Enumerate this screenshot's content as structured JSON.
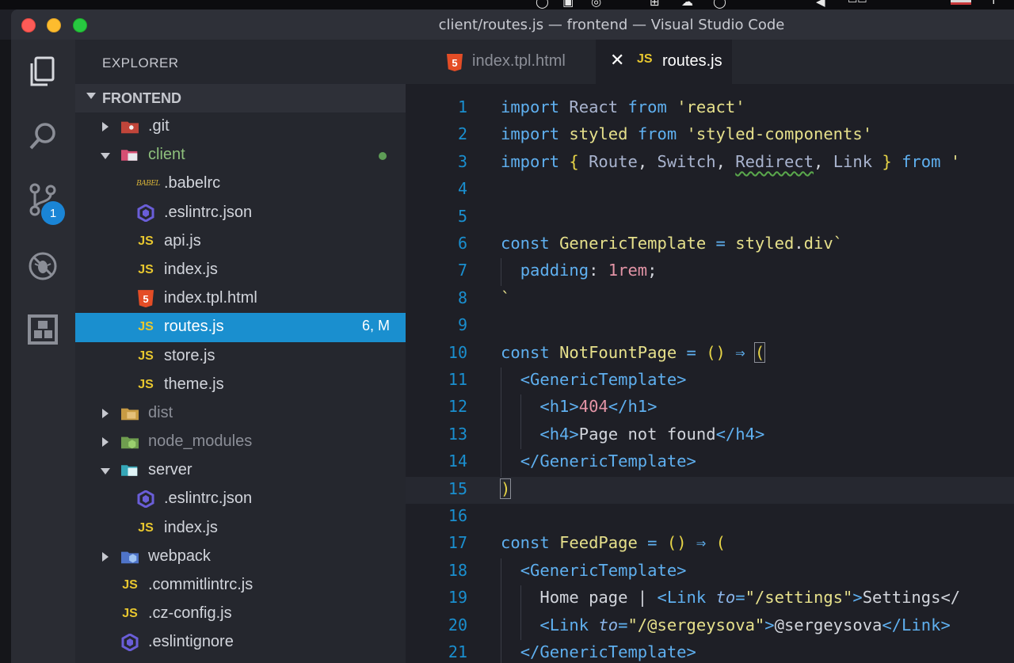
{
  "window": {
    "title": "client/routes.js — frontend — Visual Studio Code"
  },
  "activity_bar": {
    "items": [
      "explorer",
      "search",
      "source-control",
      "debug",
      "extensions"
    ],
    "scm_badge": "1"
  },
  "sidebar": {
    "title": "EXPLORER",
    "section": "FRONTEND",
    "tree": [
      {
        "name": ".git",
        "type": "folder",
        "state": "closed",
        "depth": 0
      },
      {
        "name": "client",
        "type": "folder",
        "state": "open",
        "depth": 0,
        "modified_dot": true
      },
      {
        "name": ".babelrc",
        "type": "babel",
        "depth": 1
      },
      {
        "name": ".eslintrc.json",
        "type": "eslint",
        "depth": 1
      },
      {
        "name": "api.js",
        "type": "js",
        "depth": 1
      },
      {
        "name": "index.js",
        "type": "js",
        "depth": 1
      },
      {
        "name": "index.tpl.html",
        "type": "html",
        "depth": 1
      },
      {
        "name": "routes.js",
        "type": "js",
        "depth": 1,
        "selected": true,
        "badge": "6, M"
      },
      {
        "name": "store.js",
        "type": "js",
        "depth": 1
      },
      {
        "name": "theme.js",
        "type": "js",
        "depth": 1
      },
      {
        "name": "dist",
        "type": "folder",
        "state": "closed",
        "depth": 0
      },
      {
        "name": "node_modules",
        "type": "folder",
        "state": "closed",
        "depth": 0
      },
      {
        "name": "server",
        "type": "folder",
        "state": "open",
        "depth": 0
      },
      {
        "name": ".eslintrc.json",
        "type": "eslint",
        "depth": 1
      },
      {
        "name": "index.js",
        "type": "js",
        "depth": 1
      },
      {
        "name": "webpack",
        "type": "folder",
        "state": "closed",
        "depth": 0
      },
      {
        "name": ".commitlintrc.js",
        "type": "js",
        "depth": 0
      },
      {
        "name": ".cz-config.js",
        "type": "js",
        "depth": 0
      },
      {
        "name": ".eslintignore",
        "type": "eslint",
        "depth": 0
      }
    ]
  },
  "tabs": [
    {
      "label": "index.tpl.html",
      "icon": "html5-icon",
      "active": false
    },
    {
      "label": "routes.js",
      "icon": "js-icon",
      "active": true
    }
  ],
  "editor": {
    "current_line": 15,
    "line_numbers": [
      "1",
      "2",
      "3",
      "4",
      "5",
      "6",
      "7",
      "8",
      "9",
      "10",
      "11",
      "12",
      "13",
      "14",
      "15",
      "16",
      "17",
      "18",
      "19",
      "20",
      "21"
    ],
    "lines": [
      "import React from 'react'",
      "import styled from 'styled-components'",
      "import { Route, Switch, Redirect, Link } from '",
      "",
      "",
      "const GenericTemplate = styled.div`",
      "  padding: 1rem;",
      "`",
      "",
      "const NotFountPage = () ⇒ (",
      "  <GenericTemplate>",
      "    <h1>404</h1>",
      "    <h4>Page not found</h4>",
      "  </GenericTemplate>",
      ")",
      "",
      "const FeedPage = () ⇒ (",
      "  <GenericTemplate>",
      "    Home page | <Link to=\"/settings\">Settings</",
      "    <Link to=\"/@sergeysova\">@sergeysova</Link>",
      "  </GenericTemplate>"
    ]
  },
  "colors": {
    "accent": "#1a8fcf",
    "js_yellow": "#e8c72f",
    "html_orange": "#e44d26",
    "folder_green_text": "#8ec07c"
  }
}
